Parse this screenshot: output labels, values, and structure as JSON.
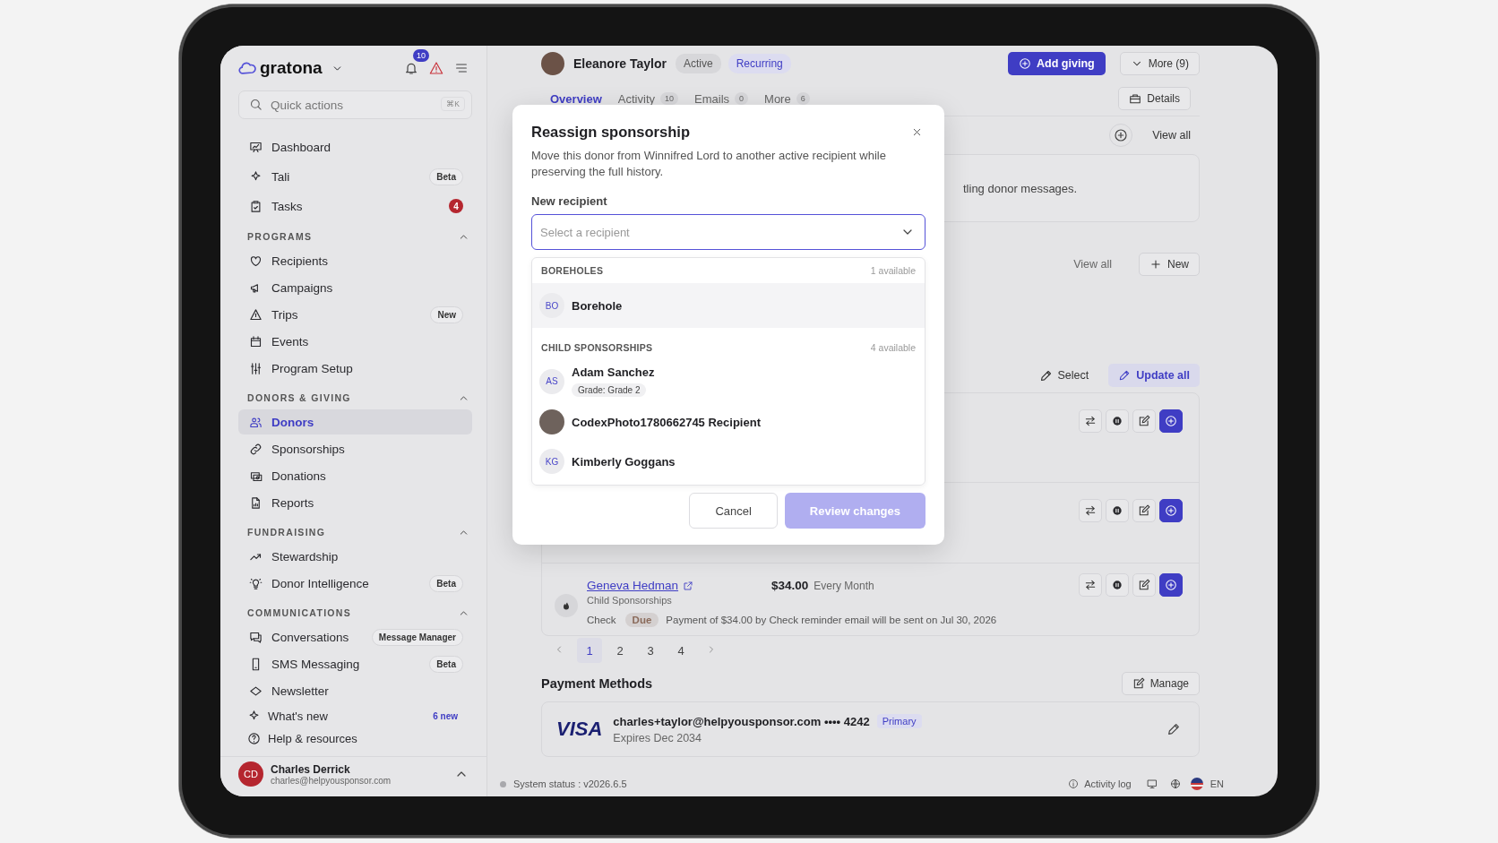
{
  "sidebar": {
    "brand": "gratona",
    "notifications": "10",
    "search": {
      "placeholder": "Quick actions",
      "shortcut": "⌘K"
    },
    "items": [
      {
        "label": "Dashboard",
        "selected": false
      },
      {
        "label": "Tali",
        "badge": "Beta",
        "kind": "pill",
        "selected": false
      },
      {
        "label": "Tasks",
        "badge": "4",
        "kind": "count",
        "selected": false
      }
    ],
    "sections": [
      {
        "title": "PROGRAMS",
        "expanded": true,
        "items": [
          {
            "label": "Recipients",
            "selected": false
          },
          {
            "label": "Campaigns",
            "selected": false
          },
          {
            "label": "Trips",
            "badge": "New",
            "kind": "pill",
            "selected": false
          },
          {
            "label": "Events",
            "selected": false
          },
          {
            "label": "Program Setup",
            "selected": false
          }
        ]
      },
      {
        "title": "DONORS & GIVING",
        "expanded": true,
        "items": [
          {
            "label": "Donors",
            "selected": true
          },
          {
            "label": "Sponsorships",
            "selected": false
          },
          {
            "label": "Donations",
            "selected": false
          },
          {
            "label": "Reports",
            "selected": false
          }
        ]
      },
      {
        "title": "FUNDRAISING",
        "expanded": true,
        "items": [
          {
            "label": "Stewardship",
            "selected": false
          },
          {
            "label": "Donor Intelligence",
            "badge": "Beta",
            "kind": "pill",
            "selected": false
          }
        ]
      },
      {
        "title": "COMMUNICATIONS",
        "expanded": true,
        "items": [
          {
            "label": "Conversations",
            "badge": "Message Manager",
            "kind": "pill",
            "selected": false
          },
          {
            "label": "SMS Messaging",
            "badge": "Beta",
            "kind": "pill",
            "selected": false
          },
          {
            "label": "Newsletter",
            "selected": false
          }
        ]
      }
    ],
    "footer_links": [
      {
        "label": "What's new",
        "badge": "6 new",
        "kind": "link",
        "selected": false
      },
      {
        "label": "Help & resources",
        "selected": false
      }
    ],
    "user": {
      "initials": "CD",
      "name": "Charles Derrick",
      "email": "charles@helpyousponsor.com"
    }
  },
  "donor": {
    "name": "Eleanore Taylor",
    "tags": [
      {
        "label": "Active",
        "kind": "neutral"
      },
      {
        "label": "Recurring",
        "kind": "accent"
      }
    ],
    "primary_action": "Add giving",
    "more_action": "More (9)",
    "details_action": "Details"
  },
  "tabs": [
    {
      "label": "Overview",
      "selected": true
    },
    {
      "label": "Activity",
      "count": "10",
      "selected": false
    },
    {
      "label": "Emails",
      "count": "0",
      "selected": false
    },
    {
      "label": "More",
      "count": "6",
      "selected": false
    }
  ],
  "notes_panel": {
    "view_all": "View all",
    "text": "tling donor messages."
  },
  "giving_panel": {
    "view_all": "View all",
    "new_action": "New"
  },
  "sponsorships": {
    "select_action": "Select",
    "update_action": "Update all",
    "rows": [
      {},
      {},
      {
        "name": "Geneva Hedman",
        "program": "Child Sponsorships",
        "amount": "$34.00",
        "frequency": "Every Month",
        "method": "Check",
        "status": "Due",
        "note": "Payment of $34.00 by Check reminder email will be sent on Jul 30, 2026"
      }
    ]
  },
  "pagination": [
    {
      "label": "1",
      "selected": true
    },
    {
      "label": "2",
      "selected": false
    },
    {
      "label": "3",
      "selected": false
    },
    {
      "label": "4",
      "selected": false
    }
  ],
  "payment_methods": {
    "title": "Payment Methods",
    "manage_action": "Manage",
    "cards": [
      {
        "brand": "VISA",
        "account": "charles+taylor@helpyousponsor.com •••• 4242",
        "primary_label": "Primary",
        "expiry": "Expires Dec 2034"
      }
    ]
  },
  "status_bar": {
    "status": "System status : v2026.6.5",
    "activity_log": "Activity log",
    "language": "EN"
  },
  "modal": {
    "title": "Reassign sponsorship",
    "description": "Move this donor from Winnifred Lord to another active recipient while preserving the full history.",
    "field_label": "New recipient",
    "placeholder": "Select a recipient",
    "groups": [
      {
        "title": "BOREHOLES",
        "count": "1 available",
        "options": [
          {
            "kind": "initials",
            "initials": "BO",
            "name": "Borehole",
            "highlighted": true
          }
        ]
      },
      {
        "title": "CHILD SPONSORSHIPS",
        "count": "4 available",
        "options": [
          {
            "kind": "initials",
            "initials": "AS",
            "name": "Adam Sanchez",
            "tag": "Grade: Grade 2",
            "highlighted": false
          },
          {
            "kind": "photo",
            "name": "CodexPhoto1780662745 Recipient",
            "highlighted": false
          },
          {
            "kind": "initials",
            "initials": "KG",
            "name": "Kimberly Goggans",
            "highlighted": false
          }
        ]
      }
    ],
    "cancel": "Cancel",
    "confirm": "Review changes",
    "confirm_disabled": true
  }
}
